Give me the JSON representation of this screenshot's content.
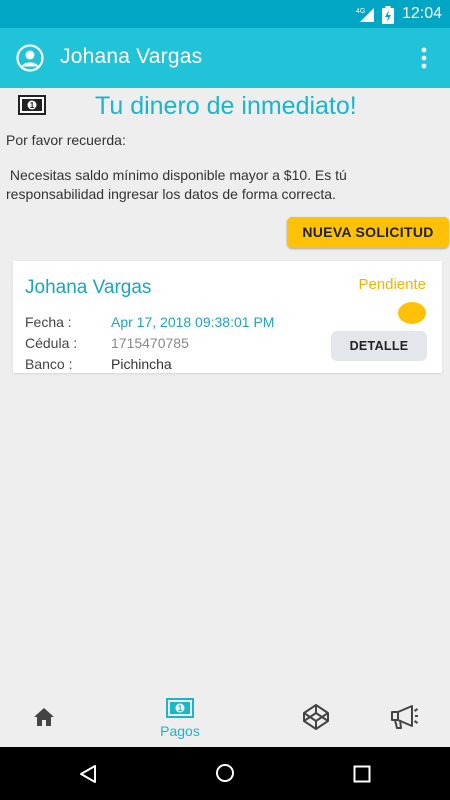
{
  "status_bar": {
    "signal": "4G",
    "time": "12:04"
  },
  "app_bar": {
    "title": "Johana Vargas"
  },
  "banner": {
    "title": "Tu dinero de inmediato!"
  },
  "reminder": "Por favor recuerda:",
  "notice": " Necesitas saldo mínimo disponible mayor a $10. Es tú responsabilidad ingresar los datos de forma correcta.",
  "new_request_label": "NUEVA SOLICITUD",
  "request": {
    "name": "Johana Vargas",
    "status": "Pendiente",
    "status_color": "#ffc107",
    "fecha_label": "Fecha :",
    "fecha_value": "Apr 17, 2018 09:38:01 PM",
    "cedula_label": "Cédula :",
    "cedula_value": "1715470785",
    "banco_label": "Banco :",
    "banco_value": "Pichincha",
    "detail_label": "DETALLE"
  },
  "bottom_nav": {
    "items": [
      {
        "icon": "home-icon",
        "label": ""
      },
      {
        "icon": "money-icon",
        "label": "Pagos",
        "active": true
      },
      {
        "icon": "codepen-icon",
        "label": ""
      },
      {
        "icon": "megaphone-icon",
        "label": ""
      }
    ]
  },
  "colors": {
    "primary": "#21c3d9",
    "status_bar": "#00a6c4",
    "accent": "#ffc107"
  }
}
